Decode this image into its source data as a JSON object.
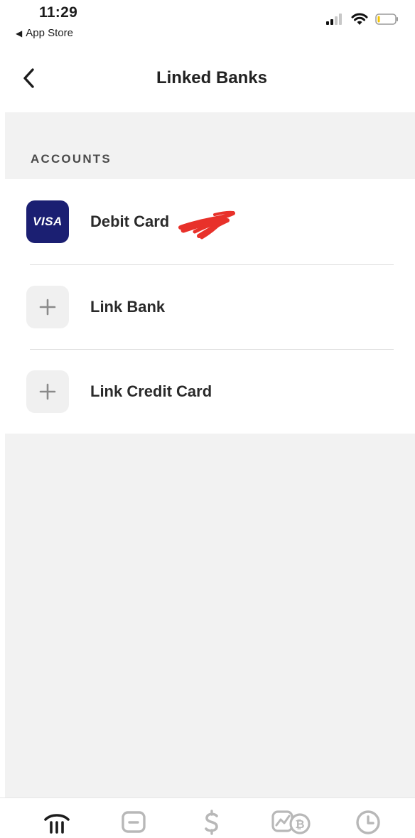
{
  "status_bar": {
    "time": "11:29",
    "back_app": "App Store"
  },
  "header": {
    "title": "Linked Banks"
  },
  "section": {
    "label": "ACCOUNTS"
  },
  "rows": [
    {
      "label": "Debit Card ",
      "icon": "visa-card-icon",
      "icon_text": "VISA"
    },
    {
      "label": "Link Bank",
      "icon": "plus-icon"
    },
    {
      "label": "Link Credit Card",
      "icon": "plus-icon"
    }
  ],
  "tab_bar": {
    "tabs": [
      "home-icon",
      "card-icon",
      "dollar-icon",
      "investing-bitcoin-icon",
      "activity-clock-icon"
    ]
  },
  "colors": {
    "visa_bg": "#1b1f72",
    "gray_bg": "#f2f2f2",
    "redaction": "#e8312a",
    "tab_inactive": "#b8b8b8",
    "tab_active": "#1c1c1c"
  }
}
